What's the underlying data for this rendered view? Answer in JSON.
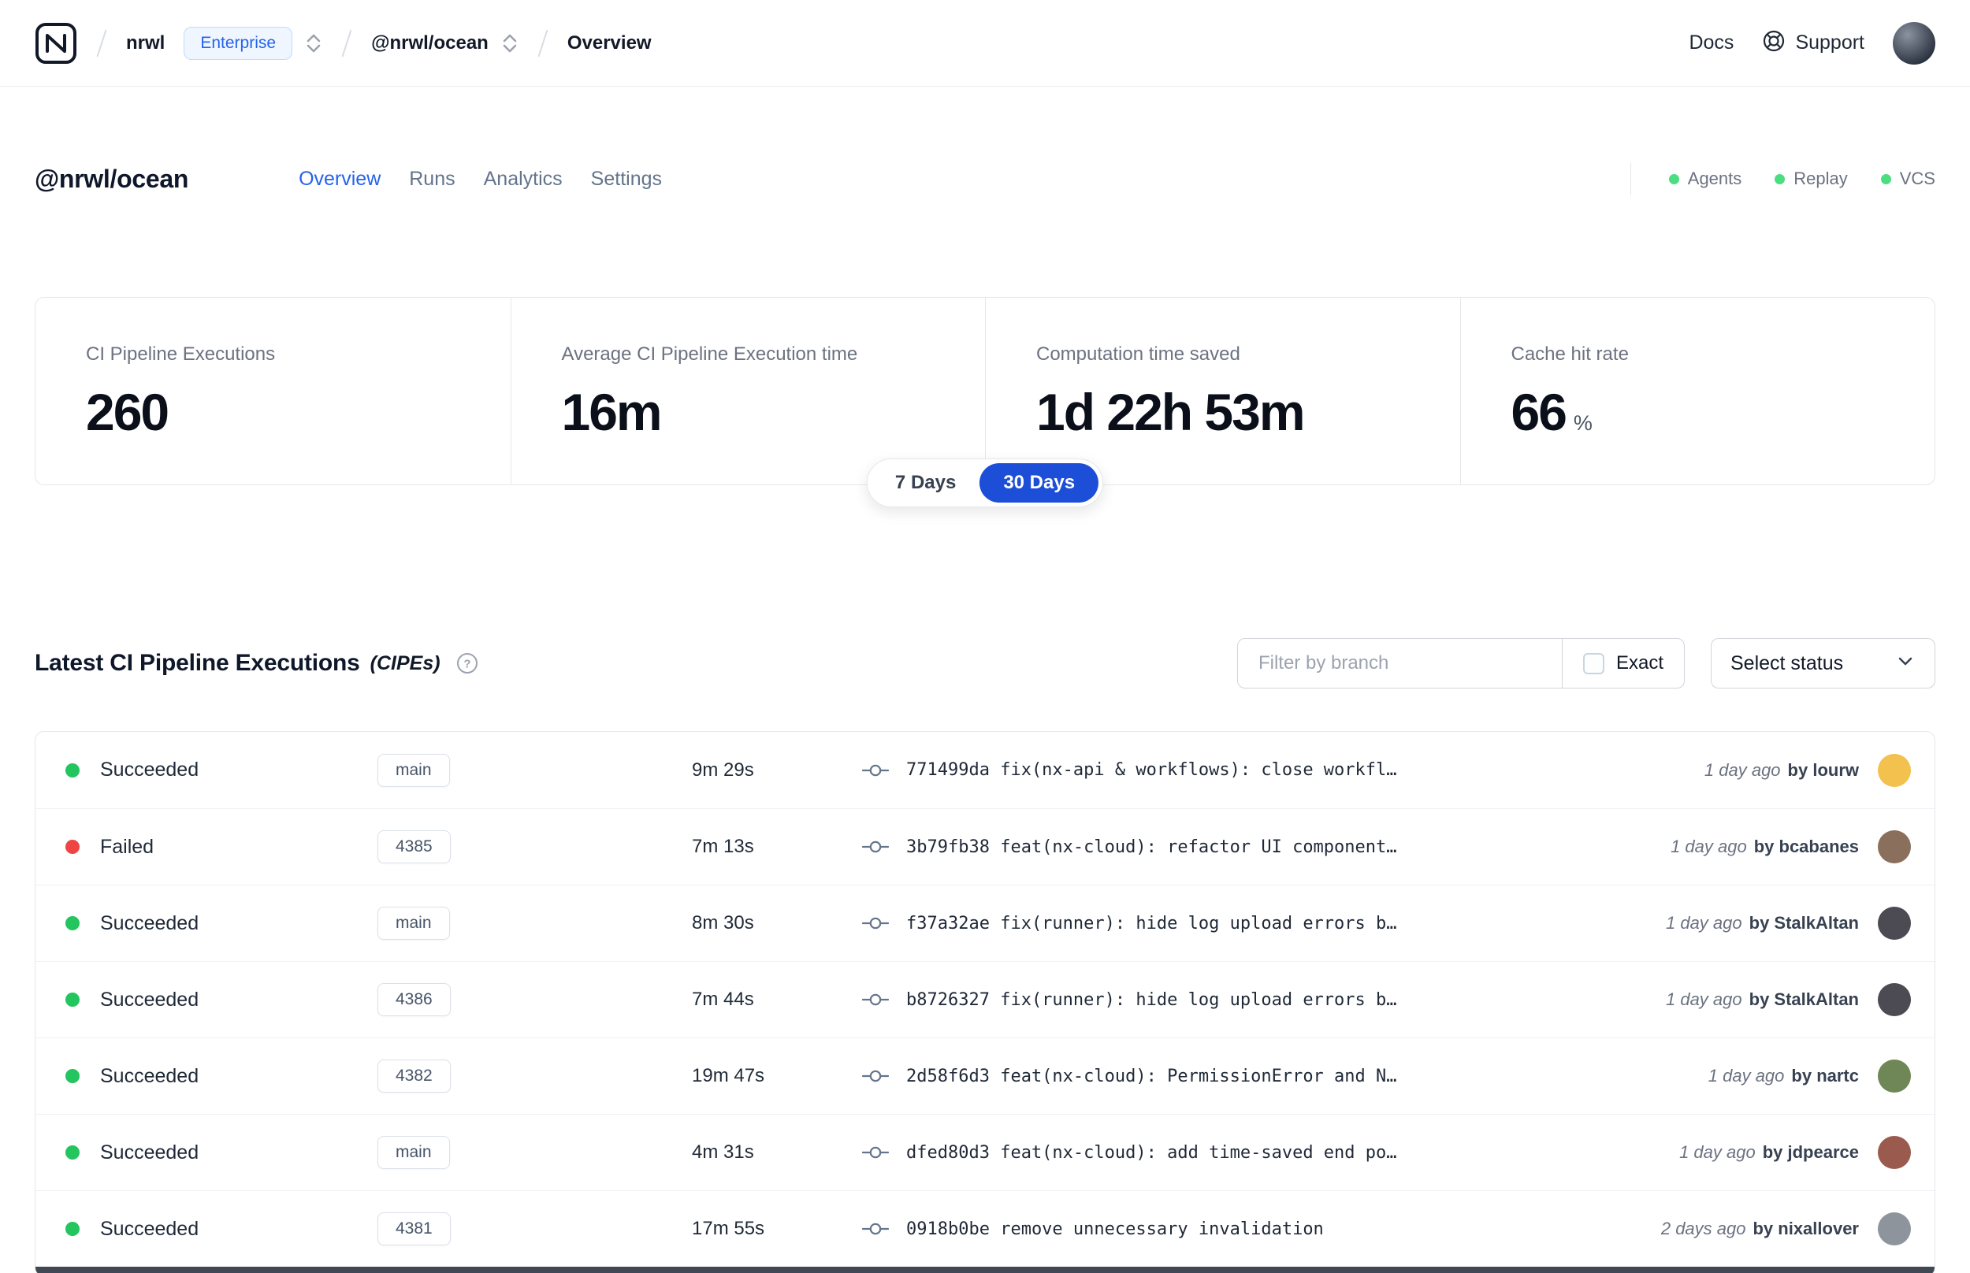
{
  "colors": {
    "accent": "#2563eb",
    "range_pill_active": "#1d4ed8",
    "success_dot": "#22c55e",
    "failed_dot": "#ef4444",
    "service_dot": "#4ade80",
    "enterprise_badge_bg": "#eff6ff"
  },
  "navbar": {
    "org": "nrwl",
    "org_badge": "Enterprise",
    "workspace": "@nrwl/ocean",
    "page": "Overview",
    "docs": "Docs",
    "support": "Support"
  },
  "header": {
    "title": "@nrwl/ocean",
    "tabs": [
      {
        "label": "Overview"
      },
      {
        "label": "Runs"
      },
      {
        "label": "Analytics"
      },
      {
        "label": "Settings"
      }
    ],
    "active_tab": "Overview",
    "services": [
      {
        "label": "Agents"
      },
      {
        "label": "Replay"
      },
      {
        "label": "VCS"
      }
    ]
  },
  "stats": {
    "cards": [
      {
        "label": "CI Pipeline Executions",
        "value": "260",
        "suffix": ""
      },
      {
        "label": "Average CI Pipeline Execution time",
        "value": "16m",
        "suffix": ""
      },
      {
        "label": "Computation time saved",
        "value": "1d 22h 53m",
        "suffix": ""
      },
      {
        "label": "Cache hit rate",
        "value": "66",
        "suffix": "%"
      }
    ],
    "range": {
      "options": [
        "7 Days",
        "30 Days"
      ],
      "selected": "30 Days"
    }
  },
  "cipes": {
    "title": "Latest CI Pipeline Executions",
    "title_suffix": "(CIPEs)",
    "filter": {
      "placeholder": "Filter by branch",
      "exact_label": "Exact",
      "exact_checked": false
    },
    "status_select": "Select status",
    "rows": [
      {
        "status": "Succeeded",
        "dot": "#22c55e",
        "branch": "main",
        "duration": "9m 29s",
        "commit": "771499da fix(nx-api & workflows): close workfl…",
        "time": "1 day ago",
        "author": "by lourw",
        "avatar": "#f2c14e"
      },
      {
        "status": "Failed",
        "dot": "#ef4444",
        "branch": "4385",
        "duration": "7m 13s",
        "commit": "3b79fb38 feat(nx-cloud): refactor UI component…",
        "time": "1 day ago",
        "author": "by bcabanes",
        "avatar": "#8a6f5c"
      },
      {
        "status": "Succeeded",
        "dot": "#22c55e",
        "branch": "main",
        "duration": "8m 30s",
        "commit": "f37a32ae fix(runner): hide log upload errors b…",
        "time": "1 day ago",
        "author": "by StalkAltan",
        "avatar": "#4c4a52"
      },
      {
        "status": "Succeeded",
        "dot": "#22c55e",
        "branch": "4386",
        "duration": "7m 44s",
        "commit": "b8726327 fix(runner): hide log upload errors b…",
        "time": "1 day ago",
        "author": "by StalkAltan",
        "avatar": "#4c4a52"
      },
      {
        "status": "Succeeded",
        "dot": "#22c55e",
        "branch": "4382",
        "duration": "19m 47s",
        "commit": "2d58f6d3 feat(nx-cloud): PermissionError and N…",
        "time": "1 day ago",
        "author": "by nartc",
        "avatar": "#6f8757"
      },
      {
        "status": "Succeeded",
        "dot": "#22c55e",
        "branch": "main",
        "duration": "4m 31s",
        "commit": "dfed80d3 feat(nx-cloud): add time-saved end po…",
        "time": "1 day ago",
        "author": "by jdpearce",
        "avatar": "#9a5a4e"
      },
      {
        "status": "Succeeded",
        "dot": "#22c55e",
        "branch": "4381",
        "duration": "17m 55s",
        "commit": "0918b0be remove unnecessary invalidation",
        "time": "2 days ago",
        "author": "by nixallover",
        "avatar": "#8e949c"
      }
    ]
  }
}
